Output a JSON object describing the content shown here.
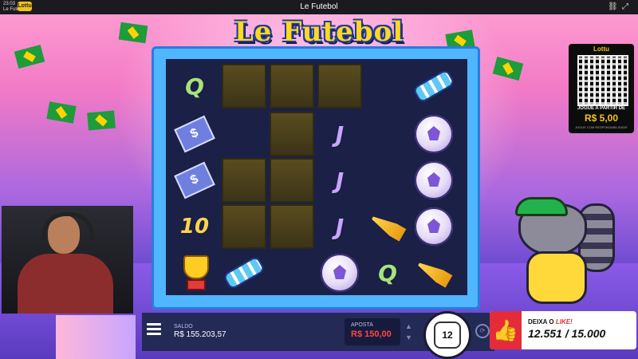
{
  "window": {
    "title": "Le Futebol",
    "clock": "23:03",
    "tab": "Le Futebol",
    "brand": "Lottu",
    "icons": [
      "link-icon",
      "expand-icon"
    ]
  },
  "game": {
    "logo": "Le Futebol",
    "grid_rows": 5,
    "grid_cols": 6,
    "cells": [
      [
        "Q",
        "empty",
        "empty",
        "empty",
        "blank",
        "scarf"
      ],
      [
        "ticket",
        "blank",
        "empty",
        "J",
        "blank",
        "ball"
      ],
      [
        "ticket",
        "empty",
        "empty",
        "J",
        "blank",
        "ball"
      ],
      [
        "10",
        "empty",
        "empty",
        "J",
        "horn",
        "ball"
      ],
      [
        "trophy",
        "scarf",
        "blank",
        "ball",
        "Q",
        "horn"
      ]
    ]
  },
  "qr_panel": {
    "brand": "Lottu",
    "line1": "JOGUE A PARTIR DE",
    "line2": "R$ 5,00",
    "line3": "JOGUE COM RESPONSABILIDADE"
  },
  "bottom": {
    "saldo_label": "SALDO",
    "saldo_value": "R$ 155.203,57",
    "bet_label": "APOSTA",
    "bet_value": "R$ 150,00",
    "spin_value": "12",
    "auto_icon": "autoplay-icon"
  },
  "like_widget": {
    "prefix": "DEIXA O ",
    "highlight": "LIKE!",
    "count": "12.551 / 15.000"
  },
  "colors": {
    "board_frame": "#4fb6ff",
    "grid_bg": "#1b2046",
    "bet_red": "#ff4747",
    "like_red": "#e52b3a"
  }
}
